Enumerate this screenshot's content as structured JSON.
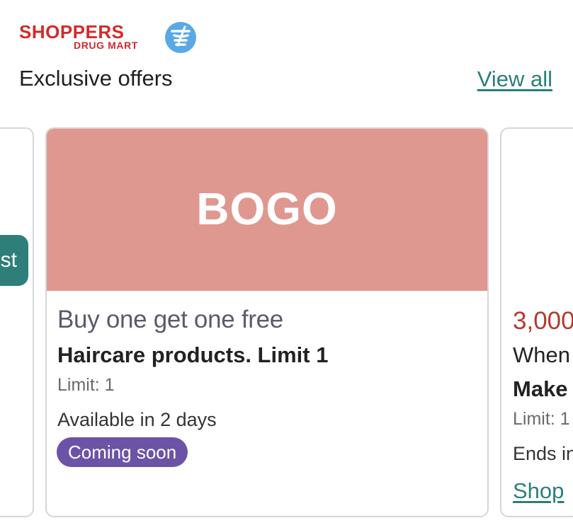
{
  "logo": {
    "word": "SHOPPERS",
    "sub": "DRUG MART"
  },
  "header": {
    "title": "Exclusive offers",
    "view_all": "View all"
  },
  "left_card": {
    "button_label": "st"
  },
  "main_card": {
    "banner": "BOGO",
    "headline": "Buy one get one free",
    "description": "Haircare products. Limit 1",
    "limit": "Limit: 1",
    "availability": "Available in 2 days",
    "badge": "Coming soon"
  },
  "right_card": {
    "points": "3,000",
    "when": "When",
    "make": "Make",
    "limit": "Limit: 1",
    "ends": "Ends in",
    "shop": "Shop"
  },
  "colors": {
    "brand_red": "#d42a2a",
    "teal_accent": "#2a7f7a",
    "banner_bg": "#df9890",
    "badge_purple": "#6b53a6",
    "points_red": "#b23a2e"
  },
  "icons": {
    "logo_mark": "mortar-pestle-icon"
  }
}
